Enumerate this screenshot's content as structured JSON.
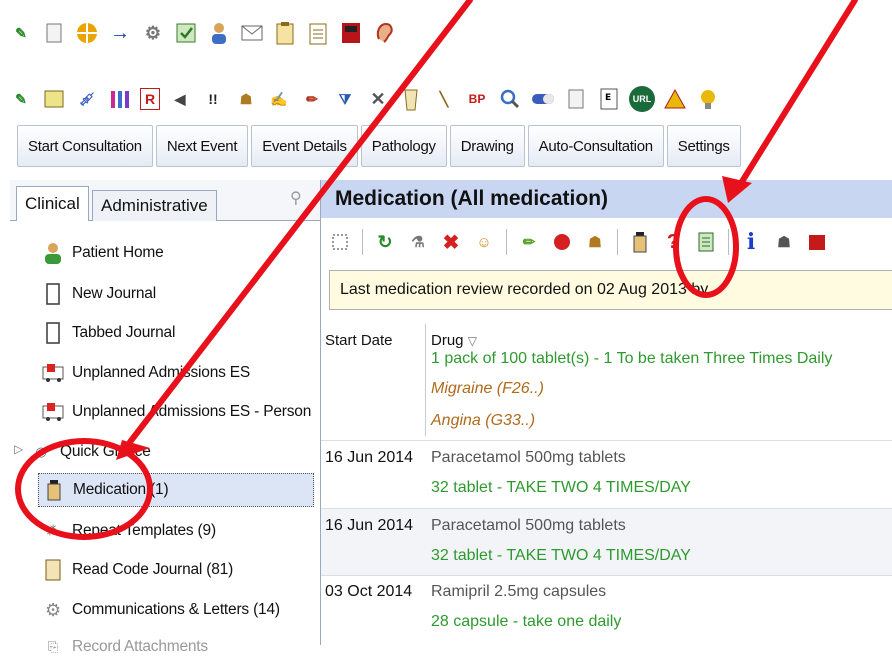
{
  "toolbar_row1_icons": [
    "edit-icon",
    "document-icon",
    "globe-icon",
    "arrow-right-icon",
    "gear-icon",
    "check-icon",
    "person-icon",
    "mail-icon",
    "clipboard-icon",
    "clipboard-list-icon",
    "book-red-icon",
    "ear-icon"
  ],
  "toolbar_row2_icons": [
    "pen-icon",
    "notepad-icon",
    "syringe-icon",
    "bars-icon",
    "r-form-icon",
    "speaker-icon",
    "exclamation-icon",
    "family-icon",
    "note-icon",
    "pencil-icon",
    "filter-icon",
    "tools-icon",
    "cup-icon",
    "needle-icon",
    "bp-icon",
    "magnifier-icon",
    "pill-icon",
    "file-icon",
    "eye-chart-icon",
    "url-icon",
    "warning-icon",
    "lamp-icon"
  ],
  "toolbar_row2_text": {
    "bp": "BP",
    "url": "URL",
    "exclaim": "!!"
  },
  "buttons": [
    "Start Consultation",
    "Next Event",
    "Event Details",
    "Pathology",
    "Drawing",
    "Auto-Consultation",
    "Settings"
  ],
  "left_tabs": [
    "Clinical",
    "Administrative"
  ],
  "nav_items": [
    {
      "label": "Patient Home",
      "icon": "person-icon"
    },
    {
      "label": "New Journal",
      "icon": "journal-icon"
    },
    {
      "label": "Tabbed Journal",
      "icon": "journal-icon"
    },
    {
      "label": "Unplanned Admissions ES",
      "icon": "ambulance-icon"
    },
    {
      "label": "Unplanned Admissions ES - Person",
      "icon": "ambulance-icon"
    },
    {
      "label": "Quick Glance",
      "icon": "eye-icon"
    },
    {
      "label": "Medication (1)",
      "icon": "bottle-icon"
    },
    {
      "label": "Repeat Templates (9)",
      "icon": "pills-icon"
    },
    {
      "label": "Read Code Journal (81)",
      "icon": "scroll-icon"
    },
    {
      "label": "Communications & Letters (14)",
      "icon": "gear-icon"
    },
    {
      "label": "Record Attachments",
      "icon": "paperclip-icon"
    }
  ],
  "medication": {
    "title": "Medication (All medication)",
    "review_text": "Last medication review recorded on 02 Aug 2013 by",
    "col_start": "Start Date",
    "col_drug": "Drug",
    "rows": [
      {
        "date": "",
        "drug": "",
        "dosage": "1 pack of 100 tablet(s) - 1 To be taken Three Times Daily",
        "problems": [
          "Migraine (F26..)",
          "Angina (G33..)"
        ]
      },
      {
        "date": "16 Jun 2014",
        "drug": "Paracetamol 500mg tablets",
        "dosage": "32 tablet - TAKE TWO 4 TIMES/DAY",
        "problems": []
      },
      {
        "date": "16 Jun 2014",
        "drug": "Paracetamol 500mg tablets",
        "dosage": "32 tablet - TAKE TWO 4 TIMES/DAY",
        "problems": []
      },
      {
        "date": "03 Oct 2014",
        "drug": "Ramipril 2.5mg capsules",
        "dosage": "28 capsule - take one daily",
        "problems": []
      }
    ]
  },
  "annotation_color": "#e8101a"
}
